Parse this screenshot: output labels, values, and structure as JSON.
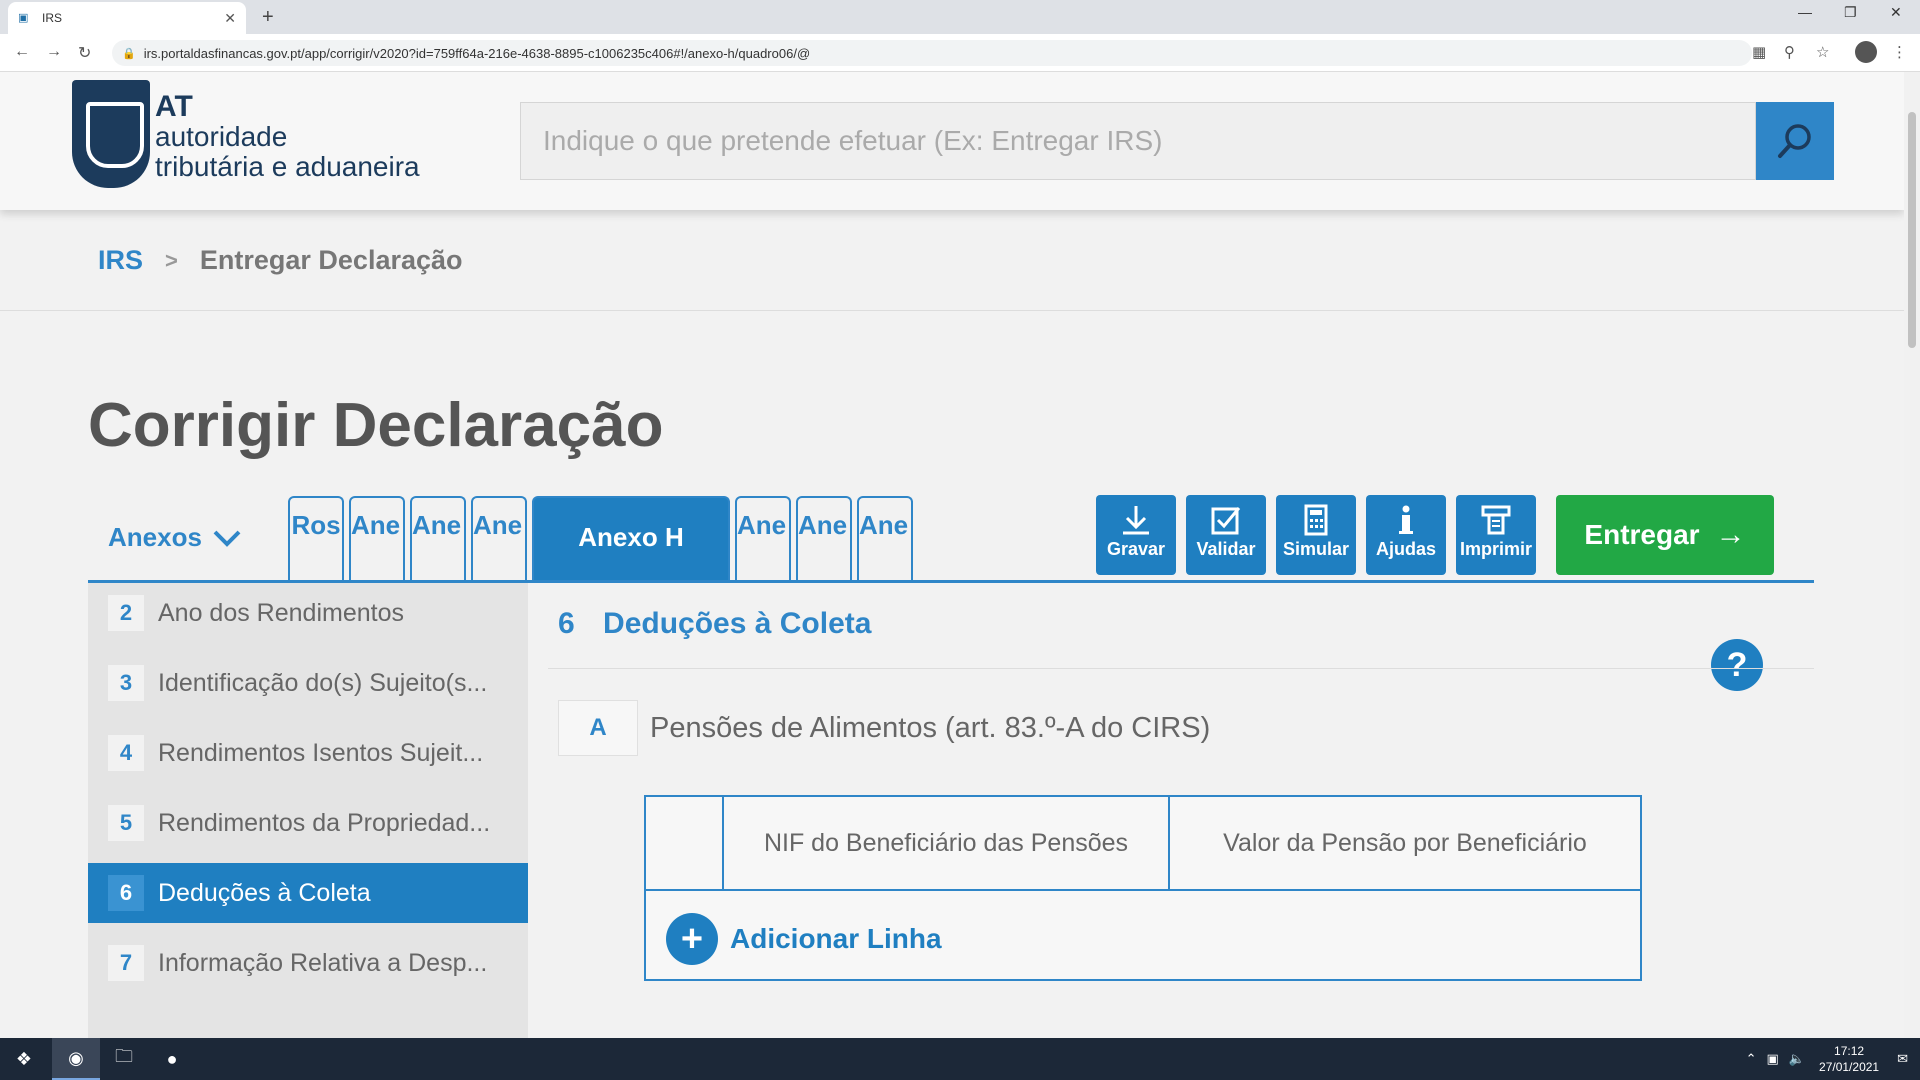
{
  "browser": {
    "tab_title": "IRS",
    "url": "irs.portaldasfinancas.gov.pt/app/corrigir/v2020?id=759ff64a-216e-4638-8895-c1006235c406#!/anexo-h/quadro06/@"
  },
  "header": {
    "logo_line1": "AT",
    "logo_line2": "autoridade",
    "logo_line3": "tributária e aduaneira",
    "search_placeholder": "Indique o que pretende efetuar (Ex: Entregar IRS)"
  },
  "breadcrumb": {
    "root": "IRS",
    "separator": ">",
    "current": "Entregar Declaração"
  },
  "page_title": "Corrigir Declaração",
  "toolbar": {
    "anexos_label": "Anexos",
    "tabs": [
      {
        "label": "Ros"
      },
      {
        "label": "Ane A"
      },
      {
        "label": "Ane B"
      },
      {
        "label": "Ane B"
      },
      {
        "label": "Anexo H"
      },
      {
        "label": "Ane J"
      },
      {
        "label": "Ane SS"
      },
      {
        "label": "Ane SS"
      }
    ],
    "actions": [
      {
        "label": "Gravar"
      },
      {
        "label": "Validar"
      },
      {
        "label": "Simular"
      },
      {
        "label": "Ajudas"
      },
      {
        "label": "Imprimir"
      }
    ],
    "submit_label": "Entregar"
  },
  "sidebar": {
    "items": [
      {
        "num": "2",
        "label": "Ano dos Rendimentos"
      },
      {
        "num": "3",
        "label": "Identificação do(s) Sujeito(s..."
      },
      {
        "num": "4",
        "label": "Rendimentos Isentos Sujeit..."
      },
      {
        "num": "5",
        "label": "Rendimentos da Propriedad..."
      },
      {
        "num": "6",
        "label": "Deduções à Coleta"
      },
      {
        "num": "7",
        "label": "Informação Relativa a Desp..."
      }
    ]
  },
  "main": {
    "section_num": "6",
    "section_title": "Deduções à Coleta",
    "help": "?",
    "sub_letter": "A",
    "sub_title": "Pensões de Alimentos (art. 83.º-A do CIRS)",
    "table": {
      "headers": [
        "",
        "NIF do Beneficiário das Pensões",
        "Valor da Pensão por Beneficiário"
      ]
    },
    "add_row_label": "Adicionar Linha"
  },
  "taskbar": {
    "time": "17:12",
    "date": "27/01/2021"
  }
}
